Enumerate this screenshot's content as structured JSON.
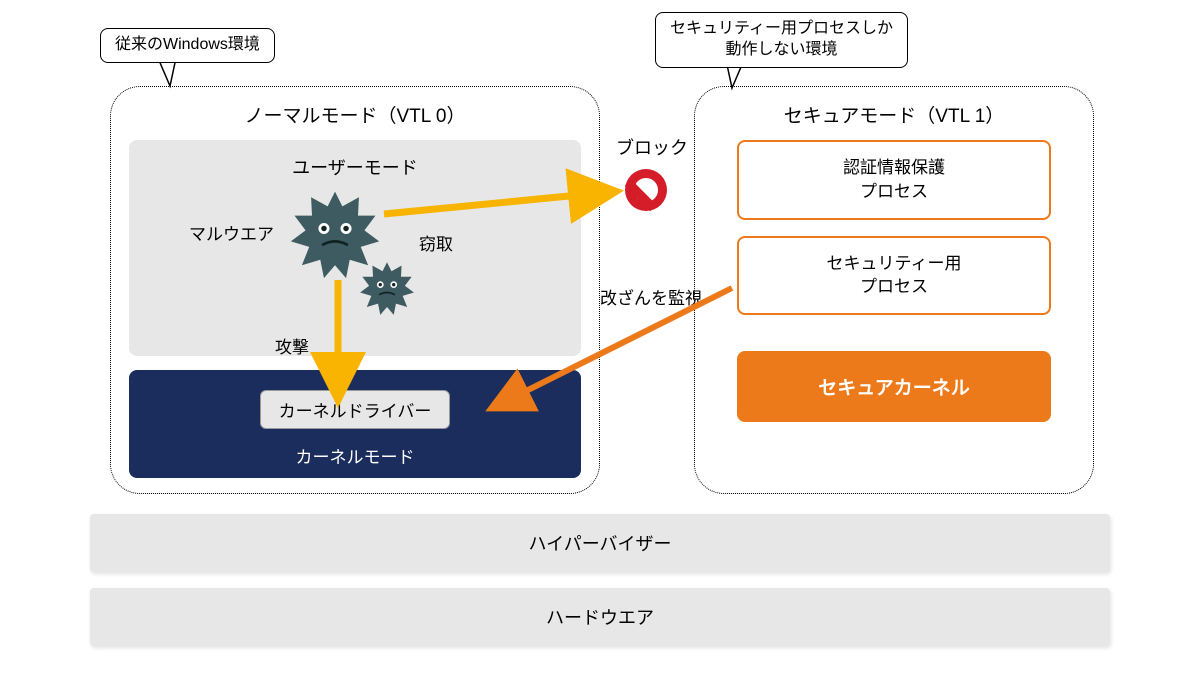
{
  "callouts": {
    "left": "従来のWindows環境",
    "right_line1": "セキュリティー用プロセスしか",
    "right_line2": "動作しない環境"
  },
  "normal_mode": {
    "title": "ノーマルモード（VTL 0）",
    "user_mode": "ユーザーモード",
    "malware": "マルウエア",
    "attack": "攻撃",
    "steal": "窃取",
    "kernel_driver": "カーネルドライバー",
    "kernel_mode": "カーネルモード"
  },
  "block": "ブロック",
  "monitor": "改ざんを監視",
  "secure_mode": {
    "title": "セキュアモード（VTL 1）",
    "cred_protect_l1": "認証情報保護",
    "cred_protect_l2": "プロセス",
    "sec_process_l1": "セキュリティー用",
    "sec_process_l2": "プロセス",
    "secure_kernel": "セキュアカーネル"
  },
  "layers": {
    "hypervisor": "ハイパーバイザー",
    "hardware": "ハードウエア"
  },
  "colors": {
    "orange": "#ec7a1a",
    "navy": "#1a2d5c",
    "gray": "#e7e7e7",
    "yellow_arrow": "#f8b400",
    "orange_arrow": "#ec7a1a",
    "red": "#d41d28",
    "virus": "#3e5b62"
  }
}
